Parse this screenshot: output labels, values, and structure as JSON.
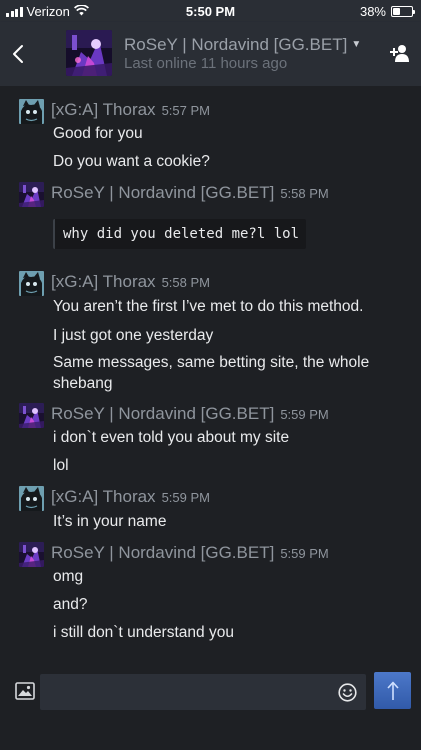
{
  "status_bar": {
    "carrier": "Verizon",
    "time": "5:50 PM",
    "battery_percent": "38%",
    "battery_level": 0.38
  },
  "header": {
    "contact_name": "RoSeY | Nordavind [GG.BET]",
    "last_online": "Last online 11 hours ago",
    "back_icon": "chevron-left-icon",
    "add_friend_icon": "add-friend-icon"
  },
  "messages": [
    {
      "sender": "[xG:A] Thorax",
      "time": "5:57 PM",
      "lines": [
        "Good for you",
        "Do you want a cookie?"
      ]
    },
    {
      "sender": "RoSeY | Nordavind [GG.BET]",
      "time": "5:58 PM",
      "quote": "why did you deleted me?l lol"
    },
    {
      "sender": "[xG:A] Thorax",
      "time": "5:58 PM",
      "lines": [
        "You aren’t the first I’ve met to do this method.",
        "I just got one yesterday",
        "Same messages, same betting site, the whole",
        "shebang"
      ]
    },
    {
      "sender": "RoSeY | Nordavind [GG.BET]",
      "time": "5:59 PM",
      "lines": [
        "i don`t even told you about my site",
        "lol"
      ]
    },
    {
      "sender": "[xG:A] Thorax",
      "time": "5:59 PM",
      "lines": [
        "It’s in your name"
      ]
    },
    {
      "sender": "RoSeY | Nordavind [GG.BET]",
      "time": "5:59 PM",
      "lines": [
        "omg",
        "and?",
        "i still don`t understand you"
      ]
    }
  ],
  "composer": {
    "value": "",
    "attach_icon": "image-icon",
    "emoji_icon": "emoji-icon",
    "send_icon": "arrow-up-icon"
  },
  "colors": {
    "background": "#1e2024",
    "header": "#2a2e35",
    "send_button": "#3d68b8"
  }
}
